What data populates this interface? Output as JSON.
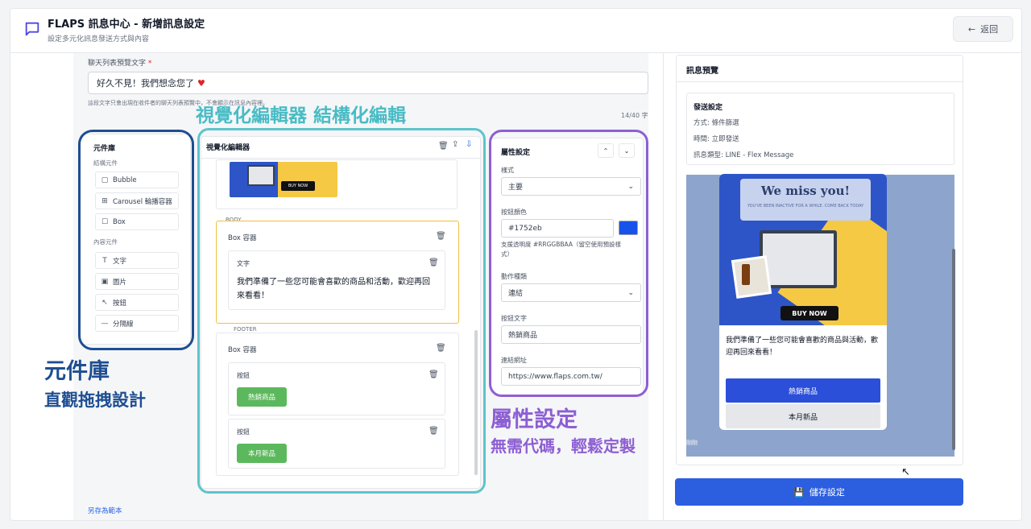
{
  "header": {
    "title": "FLAPS 訊息中心 - 新增訊息設定",
    "subtitle": "設定多元化訊息發送方式與內容",
    "back_label": "返回"
  },
  "preview_text": {
    "label": "聊天列表預覽文字",
    "required_mark": "*",
    "value": "好久不見！我們想念您了",
    "hint": "這段文字只會出現在收件者的聊天列表預覽中，不會顯示在訊息內容裡。",
    "counter": "14/40 字"
  },
  "annotations": {
    "visual_editor": "視覺化編輯器 結構化編輯",
    "library_title": "元件庫",
    "library_sub": "直觀拖拽設計",
    "props_title": "屬性設定",
    "props_sub": "無需代碼，輕鬆定製"
  },
  "library": {
    "title": "元件庫",
    "structure_heading": "結構元件",
    "structure_items": [
      "Bubble",
      "Carousel 輪播容器",
      "Box"
    ],
    "content_heading": "內容元件",
    "content_items": [
      "文字",
      "圖片",
      "按鈕",
      "分隔線"
    ]
  },
  "editor": {
    "title": "視覺化編輯器",
    "body_label": "BODY",
    "footer_label": "FOOTER",
    "box_label": "Box 容器",
    "text_label": "文字",
    "text_content": "我們準備了一些您可能會喜歡的商品和活動，歡迎再回來看看！",
    "button_label": "按鈕",
    "button1": "熱銷商品",
    "button2": "本月新品",
    "buy_now": "BUY NOW"
  },
  "properties": {
    "title": "屬性設定",
    "style_label": "樣式",
    "style_value": "主要",
    "color_label": "按鈕顏色",
    "color_value": "#1752eb",
    "color_hint": "支援透明度 #RRGGBBAA（留空使用預設樣式）",
    "action_label": "動作種類",
    "action_value": "連結",
    "button_text_label": "按鈕文字",
    "button_text_value": "熱銷商品",
    "url_label": "連結網址",
    "url_value": "https://www.flaps.com.tw/"
  },
  "preview": {
    "title": "訊息預覽",
    "send_heading": "發送設定",
    "method": "方式: 條件篩選",
    "time": "時間: 立即發送",
    "type": "訊息類型: LINE - Flex Message",
    "banner_title": "We miss you!",
    "banner_sub": "YOU'VE BEEN INACTIVE FOR A WHILE. COME BACK TODAY",
    "buy_now": "BUY NOW",
    "body_text": "我們準備了一些您可能會喜歡的商品與活動，歡迎再回來看看！",
    "btn1": "熱銷商品",
    "btn2": "本月新品",
    "footer_note": "剛剛",
    "save_label": "儲存設定"
  },
  "save_template_link": "另存為範本",
  "colors": {
    "primary": "#2b5fe0",
    "button_green": "#5cb85c",
    "annotation_teal": "#48bcc5",
    "annotation_blue": "#1e4e91",
    "annotation_purple": "#8d5fd3",
    "swatch": "#1752eb"
  }
}
